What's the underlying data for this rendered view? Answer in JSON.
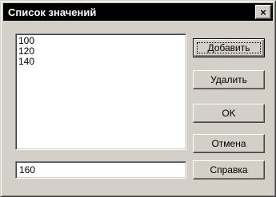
{
  "dialog": {
    "title": "Список значений",
    "close_label": "×"
  },
  "list": {
    "items": [
      "100",
      "120",
      "140"
    ]
  },
  "input": {
    "value": "160"
  },
  "buttons": {
    "add": "Добавить",
    "delete": "Удалить",
    "ok": "OK",
    "cancel": "Отмена",
    "help": "Справка"
  }
}
